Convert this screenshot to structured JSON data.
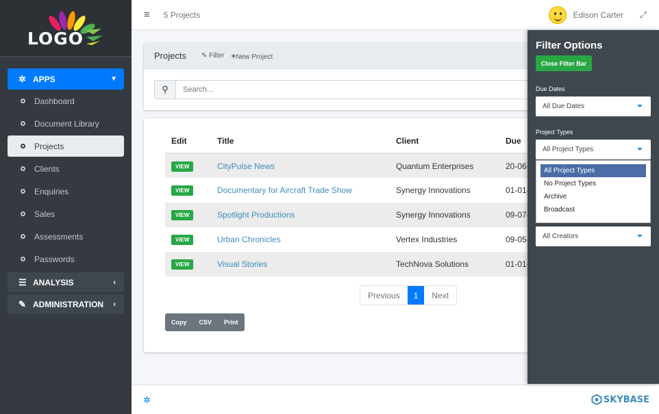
{
  "sidebar": {
    "logo_text": "LOGO",
    "apps_label": "APPS",
    "apps_items": [
      {
        "label": "Dashboard"
      },
      {
        "label": "Document Library"
      },
      {
        "label": "Projects"
      },
      {
        "label": "Clients"
      },
      {
        "label": "Enquiries"
      },
      {
        "label": "Sales"
      },
      {
        "label": "Assessments"
      },
      {
        "label": "Passwords"
      }
    ],
    "analysis_label": "ANALYSIS",
    "administration_label": "ADMINISTRATION"
  },
  "header": {
    "breadcrumb": "5 Projects",
    "user_name": "Edison Carter"
  },
  "projects_card": {
    "title": "Projects",
    "filter_link": "Filter",
    "new_project_link": "New Project",
    "search_placeholder": "Search..."
  },
  "table": {
    "headers": {
      "edit": "Edit",
      "title": "Title",
      "client": "Client",
      "due": "Due"
    },
    "view_label": "VIEW",
    "rows": [
      {
        "title": "CityPulse News",
        "client": "Quantum Enterprises",
        "due": "20-06-"
      },
      {
        "title": "Documentary for Aircraft Trade Show",
        "client": "Synergy Innovations",
        "due": "01-01-"
      },
      {
        "title": "Spotlight Productions",
        "client": "Synergy Innovations",
        "due": "09-07-"
      },
      {
        "title": "Urban Chronicles",
        "client": "Vertex Industries",
        "due": "09-05-"
      },
      {
        "title": "Visual Stories",
        "client": "TechNova Solutions",
        "due": "01-01-"
      }
    ]
  },
  "pagination": {
    "previous": "Previous",
    "current": "1",
    "next": "Next"
  },
  "export_buttons": {
    "copy": "Copy",
    "csv": "CSV",
    "print": "Print"
  },
  "filter_panel": {
    "title": "Filter Options",
    "close_button": "Close Filter Bar",
    "due_dates_label": "Due Dates",
    "due_dates_value": "All Due Dates",
    "project_types_label": "Project Types",
    "project_types_value": "All Project Types",
    "project_type_options": [
      {
        "label": "All Project Types"
      },
      {
        "label": "No Project Types"
      },
      {
        "label": "Archive"
      },
      {
        "label": "Broadcast"
      }
    ],
    "creators_value": "All Creators"
  },
  "footer": {
    "brand": "SKYBASE"
  },
  "colors": {
    "sidebar_bg": "#343a40",
    "accent_blue": "#007bff",
    "success_green": "#28a745",
    "link_blue": "#3c8dbc",
    "filter_panel_bg": "#3f474e",
    "selected_option": "#4a6da7"
  },
  "icons": {
    "apps": "gear-icon",
    "menu_bullet": "circle-icon",
    "analysis": "list-icon",
    "administration": "edit-icon",
    "hamburger": "bars-icon",
    "fullscreen": "expand-icon",
    "search": "search-icon",
    "filter": "edit-icon",
    "new_project": "plus-icon",
    "footer_settings": "gear-icon",
    "brand": "hexagon-icon"
  }
}
